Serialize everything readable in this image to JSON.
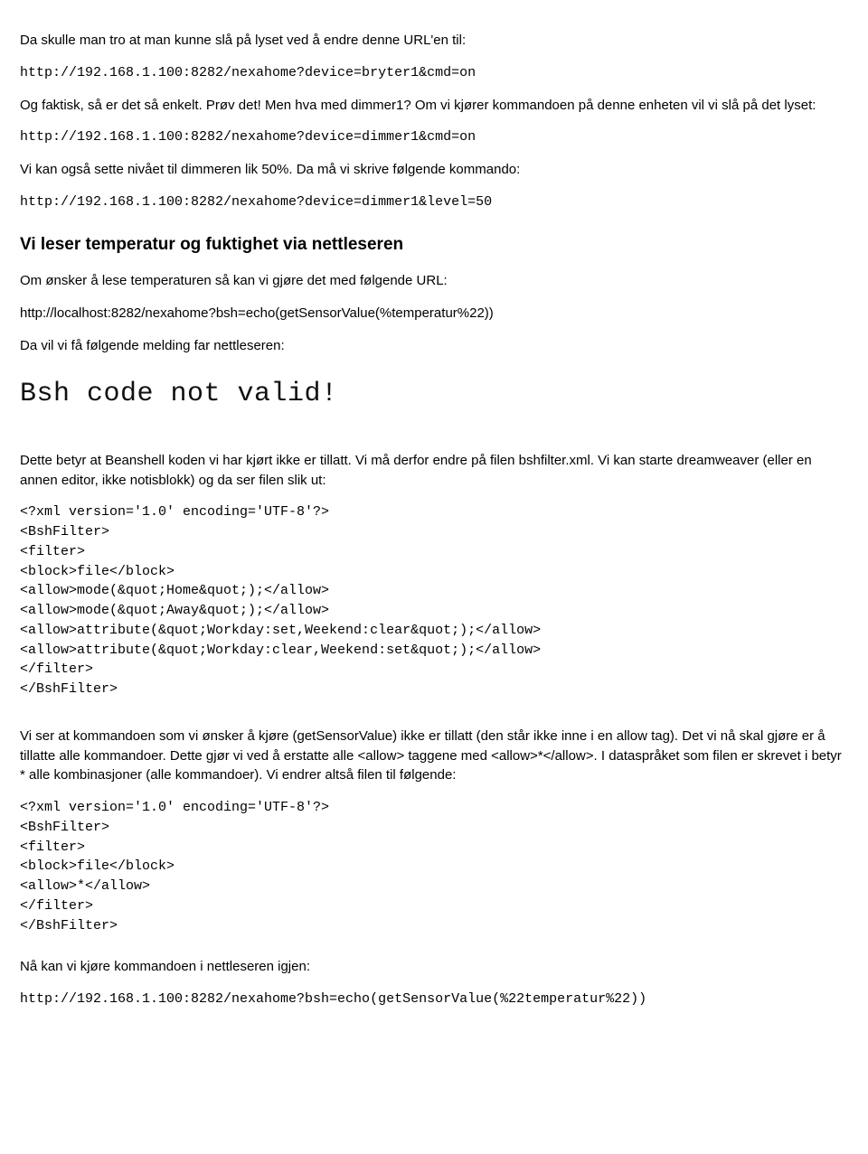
{
  "p1": "Da skulle man tro at man kunne slå på lyset ved å endre denne URL'en til:",
  "c1": "http://192.168.1.100:8282/nexahome?device=bryter1&cmd=on",
  "p2": "Og faktisk, så er det så enkelt.  Prøv det!  Men hva med dimmer1?  Om vi kjører kommandoen på denne enheten vil vi slå på det lyset:",
  "c2": "http://192.168.1.100:8282/nexahome?device=dimmer1&cmd=on",
  "p3": "Vi kan også sette nivået til dimmeren lik 50%.  Da må vi skrive følgende kommando:",
  "c3": "http://192.168.1.100:8282/nexahome?device=dimmer1&level=50",
  "h1": "Vi leser temperatur og fuktighet via nettleseren",
  "p4": "Om ønsker å lese temperaturen så kan vi gjøre det med følgende URL:",
  "p5": "http://localhost:8282/nexahome?bsh=echo(getSensorValue(%temperatur%22))",
  "p6": "Da vil vi få følgende melding far nettleseren:",
  "err": "Bsh code not valid!",
  "p7": "Dette betyr at Beanshell koden vi har kjørt ikke er tillatt.  Vi må derfor endre på filen bshfilter.xml.  Vi kan starte dreamweaver (eller en annen editor, ikke notisblokk) og da ser filen slik ut:",
  "c4": "<?xml version='1.0' encoding='UTF-8'?>\n<BshFilter>\n<filter>\n<block>file</block>\n<allow>mode(&quot;Home&quot;);</allow>\n<allow>mode(&quot;Away&quot;);</allow>\n<allow>attribute(&quot;Workday:set,Weekend:clear&quot;);</allow>\n<allow>attribute(&quot;Workday:clear,Weekend:set&quot;);</allow>\n</filter>\n</BshFilter>",
  "p8": "Vi ser at kommandoen som vi ønsker å kjøre (getSensorValue) ikke er tillatt (den står ikke inne i en allow tag).  Det vi nå skal gjøre er å tillatte alle kommandoer.  Dette gjør vi ved å erstatte alle <allow> taggene med <allow>*</allow>.  I dataspråket som filen er skrevet i betyr * alle kombinasjoner (alle kommandoer).  Vi endrer altså filen til følgende:",
  "c5": "<?xml version='1.0' encoding='UTF-8'?>\n<BshFilter>\n<filter>\n<block>file</block>\n<allow>*</allow>\n</filter>\n</BshFilter>",
  "p9": "Nå kan vi kjøre kommandoen i nettleseren igjen:",
  "c6": "http://192.168.1.100:8282/nexahome?bsh=echo(getSensorValue(%22temperatur%22))"
}
